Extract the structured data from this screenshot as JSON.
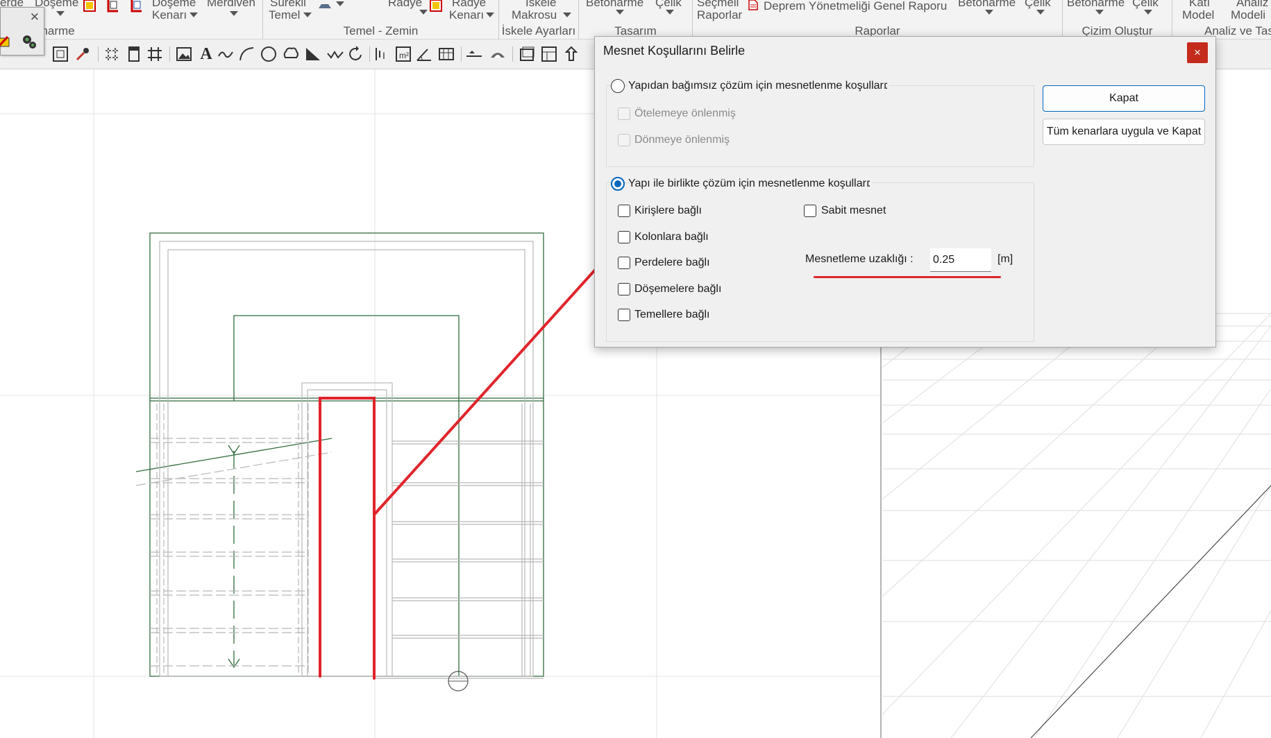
{
  "ribbon": {
    "groups": [
      {
        "title": "onarme"
      },
      {
        "title": "Temel - Zemin"
      },
      {
        "title": "İskele Ayarları"
      },
      {
        "title": "Tasarım"
      },
      {
        "title": "Raporlar"
      },
      {
        "title": "Çizim Oluştur"
      },
      {
        "title": "Analiz ve Tas"
      }
    ],
    "items": {
      "doseme_top": "Döşeme",
      "doseme_kenari": "Döşeme",
      "doseme_kenari_2": "Kenarı",
      "merdiven": "Merdiven",
      "surekli_temel_1": "Sürekli",
      "surekli_temel_2": "Temel",
      "radye": "Radye",
      "radye_kenari_1": "Radye",
      "radye_kenari_2": "Kenarı",
      "iskele_makrosu_1": "İskele",
      "iskele_makrosu_2": "Makrosu",
      "betonarme_1": "Betonarme",
      "celik_1": "Çelik",
      "secmeli_raporlar_1": "Seçmeli",
      "secmeli_raporlar_2": "Raporlar",
      "deprem_raporu": "Deprem Yönetmeliği Genel Raporu",
      "betonarme_2": "Betonarme",
      "celik_2": "Çelik",
      "betonarme_3": "Betonarme",
      "celik_3": "Çelik",
      "kati_model_1": "Katı",
      "kati_model_2": "Model",
      "analiz_modeli_1": "Analiz",
      "analiz_modeli_2": "Modeli",
      "erde": "erde"
    }
  },
  "mini_panel": {
    "close_glyph": "✕"
  },
  "dialog": {
    "title": "Mesnet Koşullarını Belirle",
    "close_glyph": "×",
    "independent": {
      "label": "Yapıdan bağımsız çözüm için mesnetlenme koşulları",
      "colon": ":",
      "selected": false,
      "options": [
        {
          "label": "Ötelemeye önlenmiş",
          "checked": false,
          "disabled": true
        },
        {
          "label": "Dönmeye önlenmiş",
          "checked": false,
          "disabled": true
        }
      ]
    },
    "with_structure": {
      "label": "Yapı ile birlikte çözüm için mesnetlenme koşulları",
      "colon": ":",
      "selected": true,
      "options_left": [
        {
          "label": "Kirişlere bağlı",
          "checked": false
        },
        {
          "label": "Kolonlara bağlı",
          "checked": false
        },
        {
          "label": "Perdelere bağlı",
          "checked": false
        },
        {
          "label": "Döşemelere bağlı",
          "checked": false
        },
        {
          "label": "Temellere bağlı",
          "checked": false
        }
      ],
      "sabit_mesnet": {
        "label": "Sabit mesnet",
        "checked": false
      },
      "uzaklik": {
        "label": "Mesnetleme uzaklığı :",
        "value": "0.25",
        "unit": "[m]"
      }
    },
    "buttons": {
      "close": "Kapat",
      "apply_all": "Tüm kenarlara uygula ve Kapat"
    }
  },
  "colors": {
    "accent": "#0067c0",
    "close_red": "#c42b1c",
    "annotation_red": "#e0242b",
    "drawing_green": "#2f6b3c"
  }
}
